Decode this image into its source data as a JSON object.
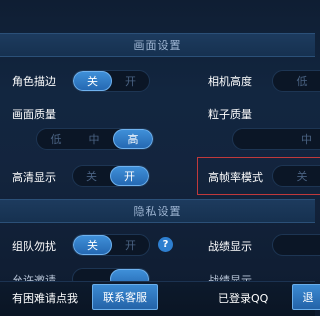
{
  "graphics_section": {
    "title": "画面设置"
  },
  "character_outline": {
    "label": "角色描边",
    "options": [
      "关",
      "开"
    ],
    "selected": "关"
  },
  "camera_height": {
    "label": "相机高度",
    "options": [
      "低"
    ]
  },
  "graphics_quality": {
    "label": "画面质量",
    "options": [
      "低",
      "中",
      "高"
    ],
    "selected": "高"
  },
  "particle_quality": {
    "label": "粒子质量",
    "options": [
      "中"
    ]
  },
  "hd_display": {
    "label": "高清显示",
    "options": [
      "关",
      "开"
    ],
    "selected": "开"
  },
  "high_fps_mode": {
    "label": "高帧率模式",
    "options": [
      "关"
    ]
  },
  "privacy_section": {
    "title": "隐私设置"
  },
  "team_no_disturb": {
    "label": "组队勿扰",
    "options": [
      "关",
      "开"
    ],
    "selected": "关",
    "help": "?"
  },
  "record_display": {
    "label": "战绩显示"
  },
  "partial_row": {
    "left_label": "允许邀请",
    "right_label": "战绩显示"
  },
  "bottom_bar": {
    "help_text": "有困难请点我",
    "contact_button": "联系客服",
    "login_status": "已登录QQ",
    "right_button": "退"
  }
}
